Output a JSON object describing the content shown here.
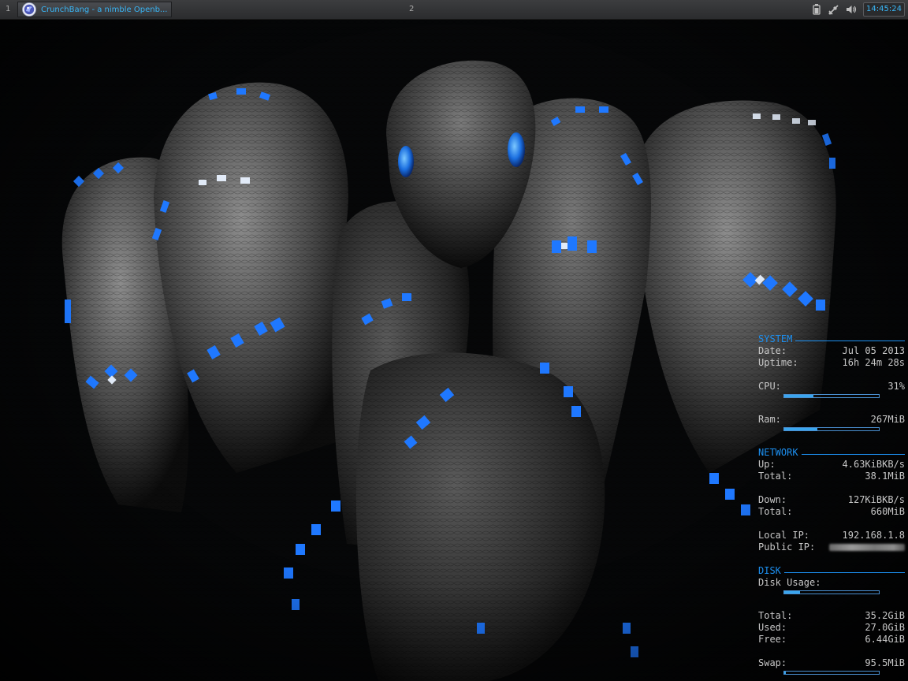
{
  "panel": {
    "workspace_1": "1",
    "workspace_2": "2",
    "task": {
      "title": "CrunchBang - a nimble Openb...",
      "icon": "crunchbang-logo-icon"
    },
    "tray_icons": [
      "battery-icon",
      "network-icon",
      "volume-icon"
    ],
    "clock": "14:45:24"
  },
  "colors": {
    "accent": "#1c8ff0",
    "panel_bg": "#2f3032",
    "text": "#c7c7c7",
    "clock_text": "#39b6f6"
  },
  "conky": {
    "system": {
      "title": "SYSTEM",
      "date_label": "Date:",
      "date_value": "Jul 05 2013",
      "uptime_label": "Uptime:",
      "uptime_value": "16h 24m 28s",
      "cpu_label": "CPU:",
      "cpu_value": "31%",
      "cpu_fraction": 0.31,
      "ram_label": "Ram:",
      "ram_value": "267MiB",
      "ram_fraction": 0.35
    },
    "network": {
      "title": "NETWORK",
      "up_label": "Up:",
      "up_value": "4.63KiBKB/s",
      "up_total_label": "Total:",
      "up_total_value": "38.1MiB",
      "down_label": "Down:",
      "down_value": "127KiBKB/s",
      "down_total_label": "Total:",
      "down_total_value": "660MiB",
      "local_ip_label": "Local IP:",
      "local_ip_value": "192.168.1.8",
      "public_ip_label": "Public IP:"
    },
    "disk": {
      "title": "DISK",
      "usage_label": "Disk Usage:",
      "usage_fraction": 0.17,
      "total_label": "Total:",
      "total_value": "35.2GiB",
      "used_label": "Used:",
      "used_value": "27.0GiB",
      "free_label": "Free:",
      "free_value": "6.44GiB",
      "swap_label": "Swap:",
      "swap_value": "95.5MiB",
      "swap_fraction": 0.02
    }
  }
}
